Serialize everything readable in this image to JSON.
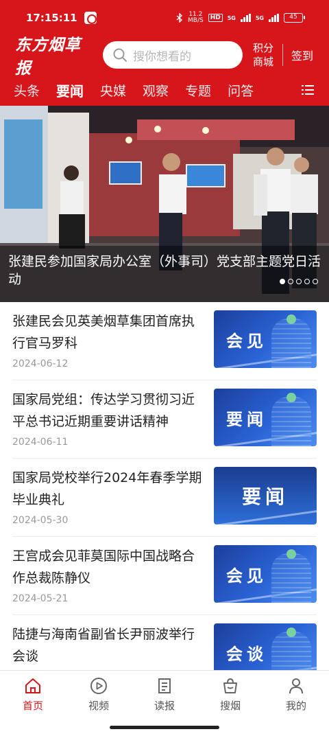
{
  "status_bar": {
    "time": "17:15:11",
    "speed_value": "11.2",
    "speed_unit": "MB/S",
    "hd_label": "HD",
    "battery": "45",
    "signal_1": "5G",
    "signal_2": "5G"
  },
  "header": {
    "logo": "东方烟草报",
    "search_placeholder": "搜你想看的",
    "points_mall_line1": "积分",
    "points_mall_line2": "商城",
    "signin": "签到"
  },
  "tabs": [
    {
      "label": "头条",
      "active": false
    },
    {
      "label": "要闻",
      "active": true
    },
    {
      "label": "央媒",
      "active": false
    },
    {
      "label": "观察",
      "active": false
    },
    {
      "label": "专题",
      "active": false
    },
    {
      "label": "问答",
      "active": false
    }
  ],
  "banner": {
    "caption": "张建民参加国家局办公室（外事司）党支部主题党日活动",
    "slide_count": 5,
    "active_slide": 1
  },
  "news": [
    {
      "title": "张建民会见英美烟草集团首席执行官马罗科",
      "date": "2024-06-12",
      "thumb_label": "会见"
    },
    {
      "title": "国家局党组：传达学习贯彻习近平总书记近期重要讲话精神",
      "date": "2024-06-11",
      "thumb_label": "要闻"
    },
    {
      "title": "国家局党校举行2024年春季学期毕业典礼",
      "date": "2024-05-30",
      "thumb_label": "要闻"
    },
    {
      "title": "王宫成会见菲莫国际中国战略合作总裁陈静仪",
      "date": "2024-05-21",
      "thumb_label": "会见"
    },
    {
      "title": "陆捷与海南省副省长尹丽波举行会谈",
      "date": "",
      "thumb_label": "会谈"
    }
  ],
  "bottom_nav": [
    {
      "label": "首页",
      "icon": "home-icon",
      "active": true
    },
    {
      "label": "视频",
      "icon": "video-play-icon",
      "active": false
    },
    {
      "label": "读报",
      "icon": "newspaper-icon",
      "active": false
    },
    {
      "label": "搜烟",
      "icon": "shopping-bag-icon",
      "active": false
    },
    {
      "label": "我的",
      "icon": "user-icon",
      "active": false
    }
  ],
  "colors": {
    "brand_red": "#d7161c",
    "accent_blue": "#2a63d6"
  }
}
